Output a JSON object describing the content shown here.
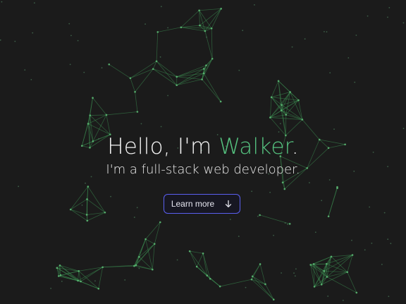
{
  "hero": {
    "greeting": "Hello, I'm ",
    "name": "Walker",
    "greeting_end": ".",
    "tagline": "I'm a full-stack web developer.",
    "button_label": "Learn more",
    "button_icon": "arrow-down-icon"
  },
  "colors": {
    "background": "#1b1b1b",
    "accent": "#55c27f",
    "network": "#3d8f52",
    "button_border": "#5a5ff0"
  }
}
